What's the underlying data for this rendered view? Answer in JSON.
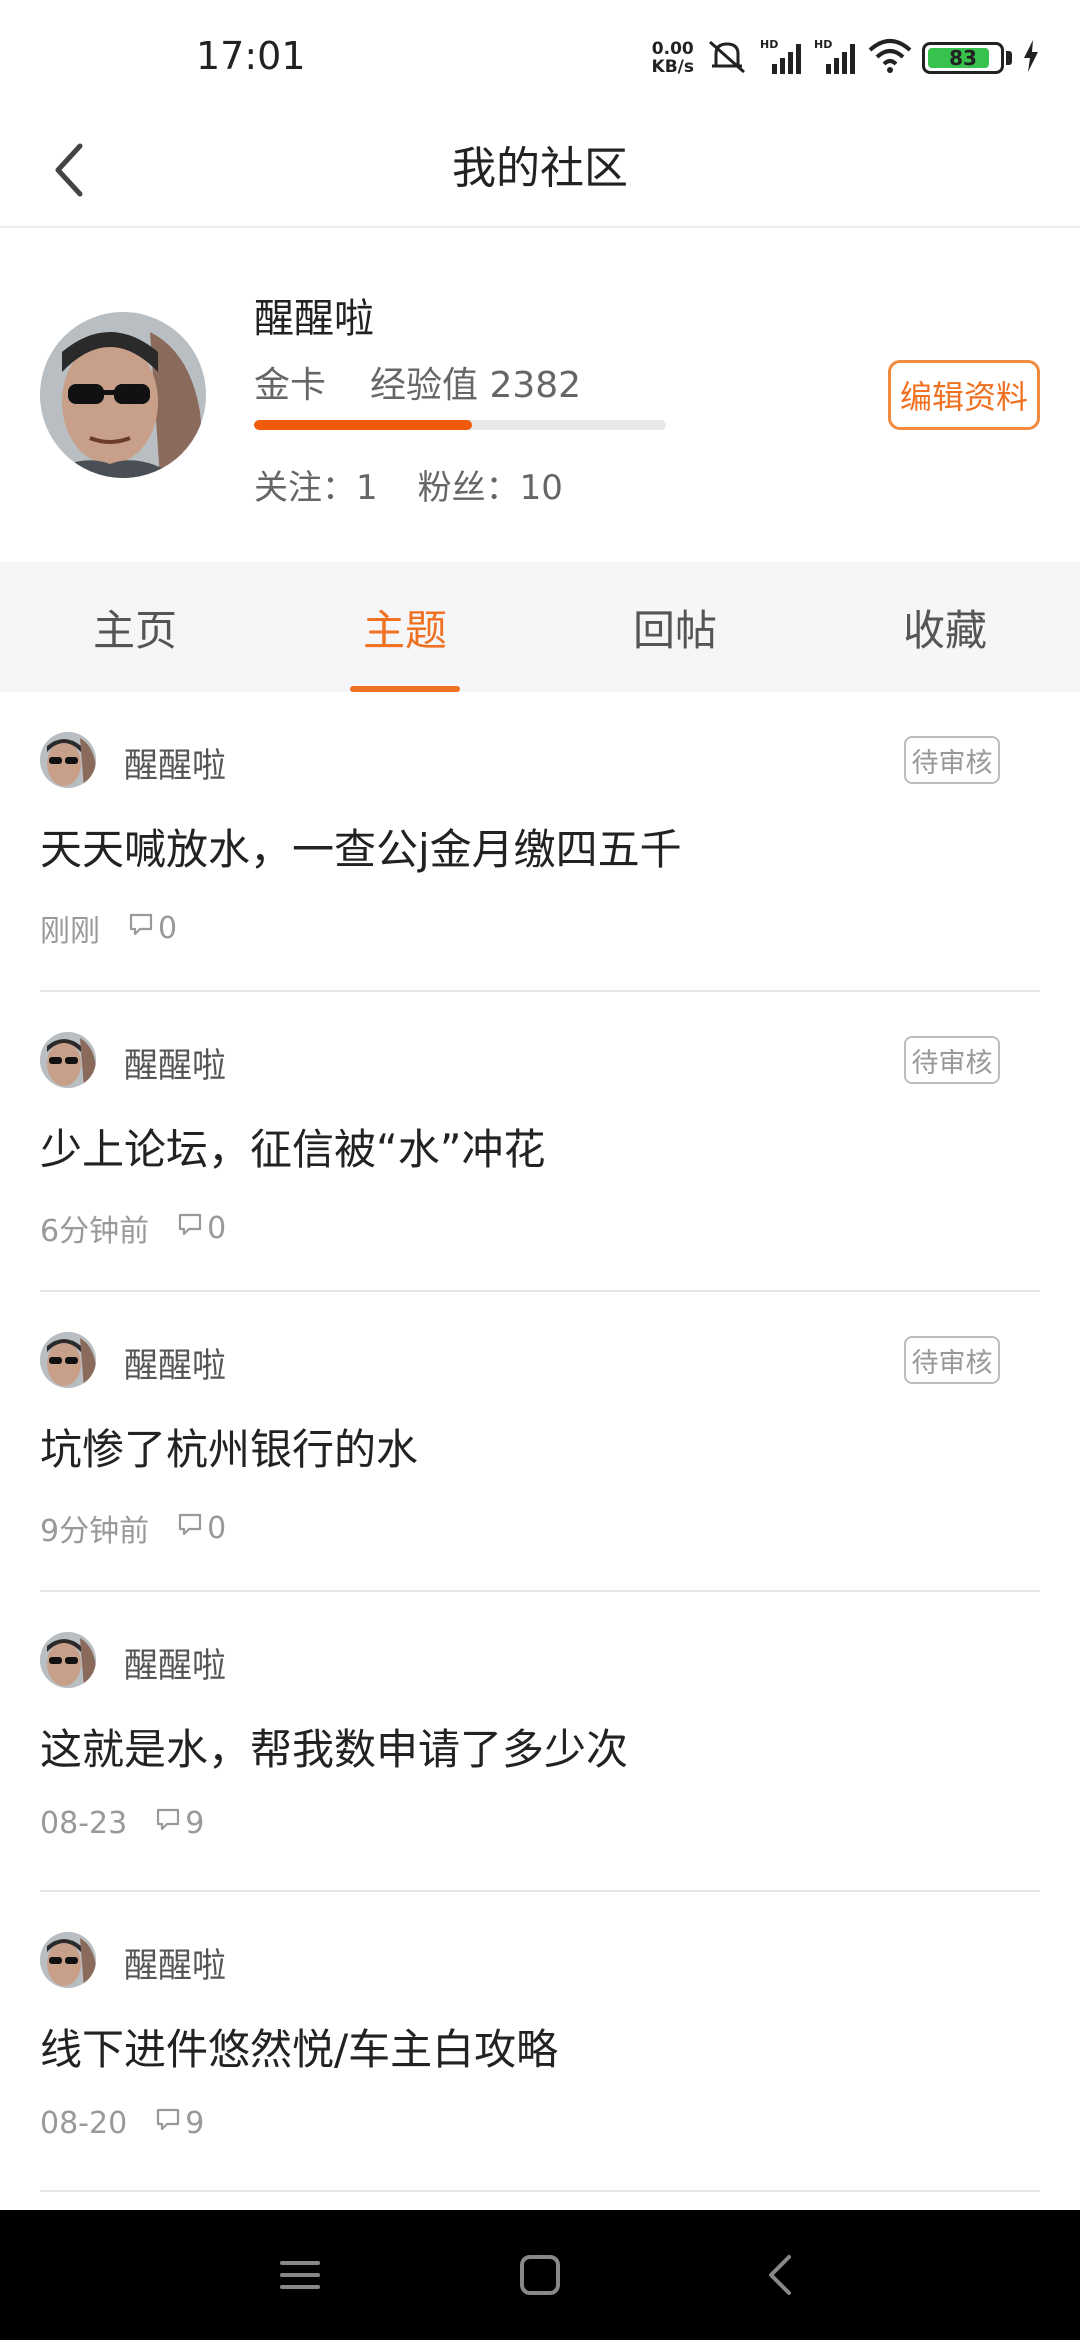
{
  "status_bar": {
    "time": "17:01",
    "net_speed_value": "0.00",
    "net_speed_unit": "KB/s",
    "battery": "83",
    "icons": [
      "mute-icon",
      "signal-hd-icon",
      "signal-hd-icon",
      "wifi-icon",
      "battery-icon",
      "charging-icon"
    ]
  },
  "nav": {
    "title": "我的社区",
    "back_icon": "chevron-left-icon"
  },
  "profile": {
    "username": "醒醒啦",
    "level": "金卡",
    "exp_label": "经验值 2382",
    "exp_progress_fraction": 0.53,
    "following": "关注：1",
    "followers": "粉丝：10",
    "edit_button": "编辑资料"
  },
  "tabs": [
    {
      "label": "主页",
      "active": false
    },
    {
      "label": "主题",
      "active": true
    },
    {
      "label": "回帖",
      "active": false
    },
    {
      "label": "收藏",
      "active": false
    }
  ],
  "posts": [
    {
      "author": "醒醒啦",
      "badge": "待审核",
      "title": "天天喊放水，一查公j金月缴四五千",
      "time": "刚刚",
      "comments": "0"
    },
    {
      "author": "醒醒啦",
      "badge": "待审核",
      "title": "少上论坛，征信被“水”冲花",
      "time": "6分钟前",
      "comments": "0"
    },
    {
      "author": "醒醒啦",
      "badge": "待审核",
      "title": "坑惨了杭州银行的水",
      "time": "9分钟前",
      "comments": "0"
    },
    {
      "author": "醒醒啦",
      "badge": "",
      "title": "这就是水，帮我数申请了多少次",
      "time": "08-23",
      "comments": "9"
    },
    {
      "author": "醒醒啦",
      "badge": "",
      "title": "线下进件悠然悦/车主白攻略",
      "time": "08-20",
      "comments": "9"
    }
  ],
  "colors": {
    "accent": "#f07122",
    "tab_bg": "#f5f6f7",
    "divider": "#e6e6e6"
  }
}
